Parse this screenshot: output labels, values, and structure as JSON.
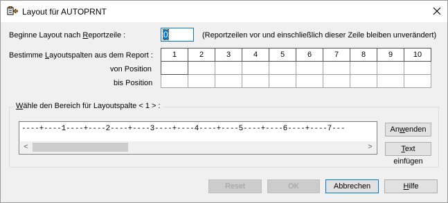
{
  "window": {
    "title": "Layout für AUTOPRNT",
    "close_label": "×"
  },
  "start": {
    "label_pre": "Beginne Layout nach ",
    "label_u": "R",
    "label_post": "eportzeile :",
    "value": "0",
    "hint": "(Reportzeilen vor und einschließlich dieser Zeile bleiben unverändert)"
  },
  "columns": {
    "label_pre": "Bestimme ",
    "label_u": "L",
    "label_post": "ayoutspalten aus dem Report :",
    "from_label": "von Position",
    "to_label": "bis Position",
    "headers": [
      "1",
      "2",
      "3",
      "4",
      "5",
      "6",
      "7",
      "8",
      "9",
      "10"
    ]
  },
  "range": {
    "label_u": "W",
    "label_post": "ähle den Bereich für Layoutspalte  < 1 > :",
    "ruler": "----+----1----+----2----+----3----+----4----+----5----+----6----+----7---",
    "scroll_left": "<",
    "scroll_right": ">"
  },
  "buttons": {
    "apply_pre": "An",
    "apply_u": "w",
    "apply_post": "enden",
    "insert_u": "T",
    "insert_post": "ext einfügen",
    "reset": "Reset",
    "ok": "OK",
    "cancel": "Abbrechen",
    "help_u": "H",
    "help_post": "ilfe"
  }
}
